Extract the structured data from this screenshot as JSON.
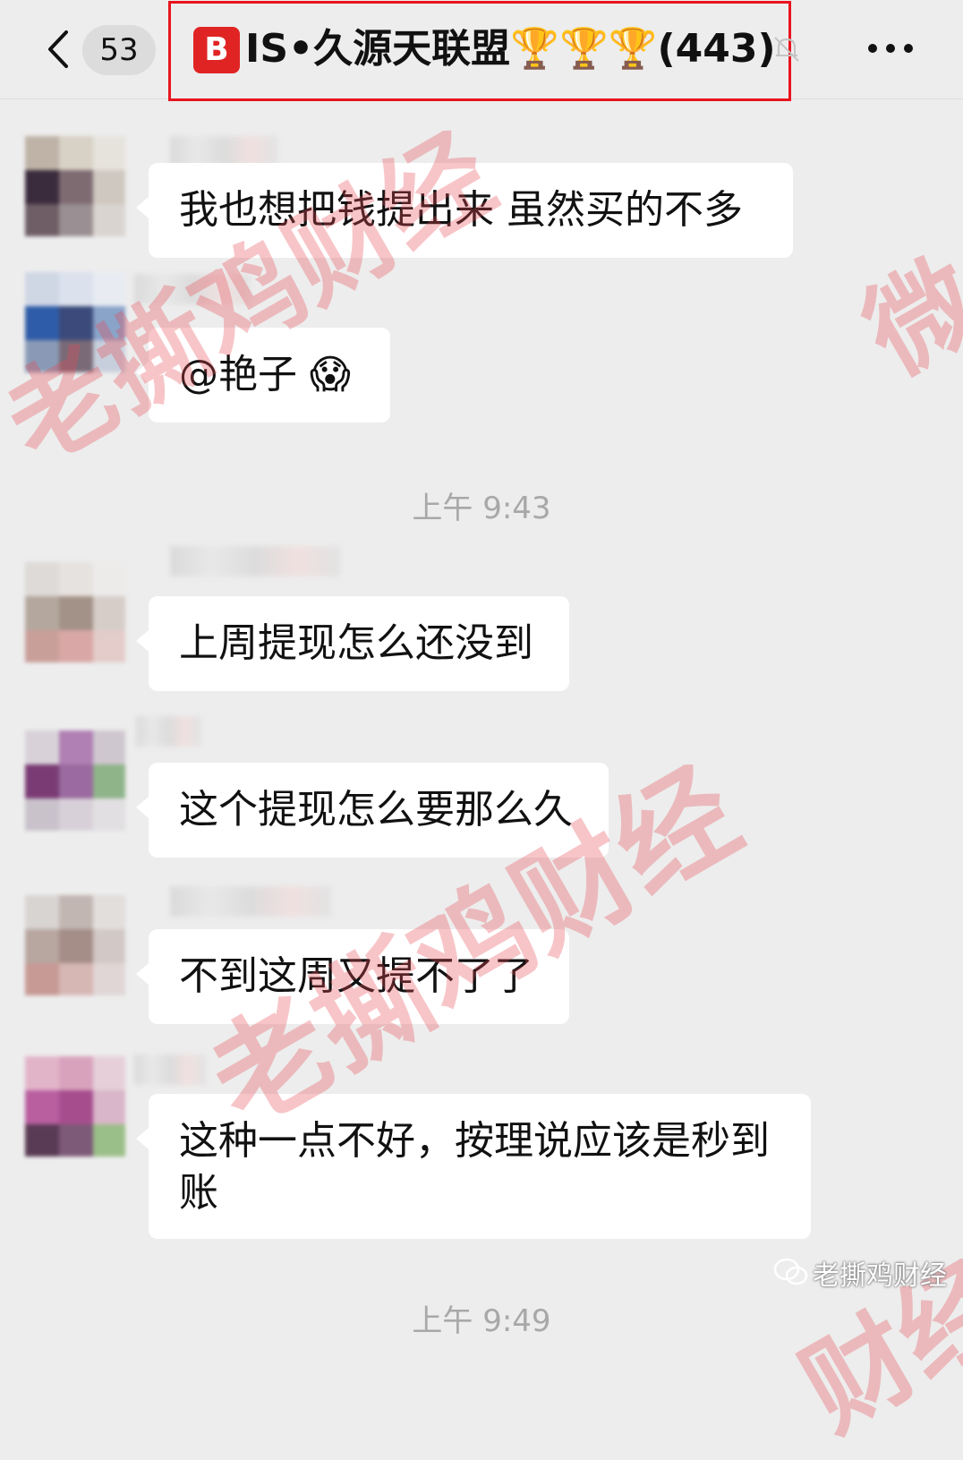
{
  "header": {
    "back_icon": "chevron-left-icon",
    "unread_count": "53",
    "group_badge_letter": "B",
    "group_title": "IS•久源天联盟🏆🏆🏆(443)",
    "mute_icon": "bell-off-icon",
    "more_icon": "ellipsis-icon",
    "highlight_color": "#e8141e"
  },
  "messages": [
    {
      "text": "我也想把钱提出来  虽然买的不多"
    },
    {
      "text": "@艳子 😱"
    },
    {
      "text": "上周提现怎么还没到"
    },
    {
      "text": "这个提现怎么要那么久"
    },
    {
      "text": "不到这周又提不了了"
    },
    {
      "text": "这种一点不好，按理说应该是秒到账"
    }
  ],
  "timestamps": [
    "上午 9:43",
    "上午 9:49"
  ],
  "watermark": {
    "main": "老撕鸡财经",
    "partial_right": "微信",
    "partial_bottom": "财经"
  },
  "footer": {
    "logo_icon": "wechat-official-account-icon",
    "account_name": "老撕鸡财经"
  },
  "colors": {
    "background": "#ededed",
    "bubble": "#ffffff",
    "watermark": "#e74c54"
  }
}
